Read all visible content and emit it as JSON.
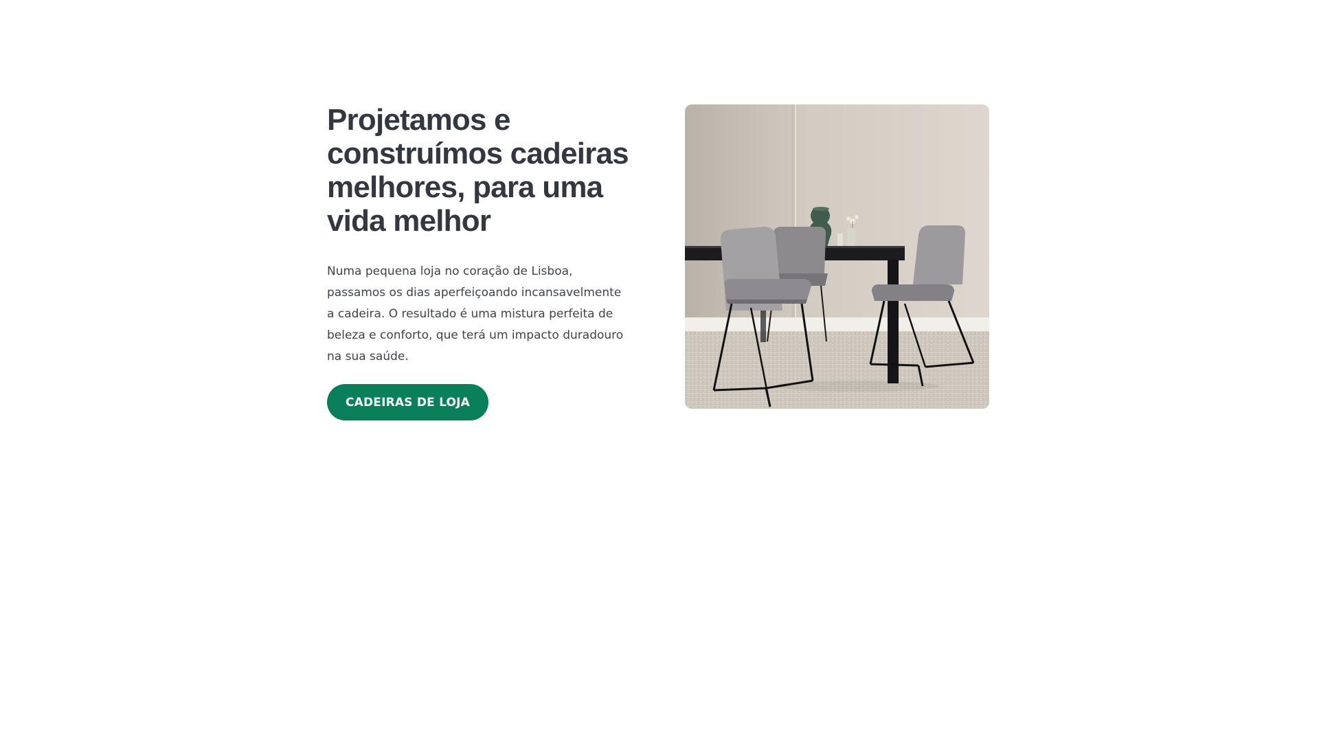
{
  "hero": {
    "title": "Projetamos e construímos cadeiras melhores, para uma vida melhor",
    "description": "Numa pequena loja no coração de Lisboa, passamos os dias aperfeiçoando incansavelmente a cadeira. O resultado é uma mistura perfeita de beleza e conforto, que terá um impacto duradouro na sua saúde.",
    "cta_label": "CADEIRAS DE LOJA",
    "image_icon": "dining-room-photo"
  },
  "colors": {
    "primary": "#087f58",
    "heading": "#333740",
    "body_text": "#40434b",
    "background": "#ffffff"
  }
}
